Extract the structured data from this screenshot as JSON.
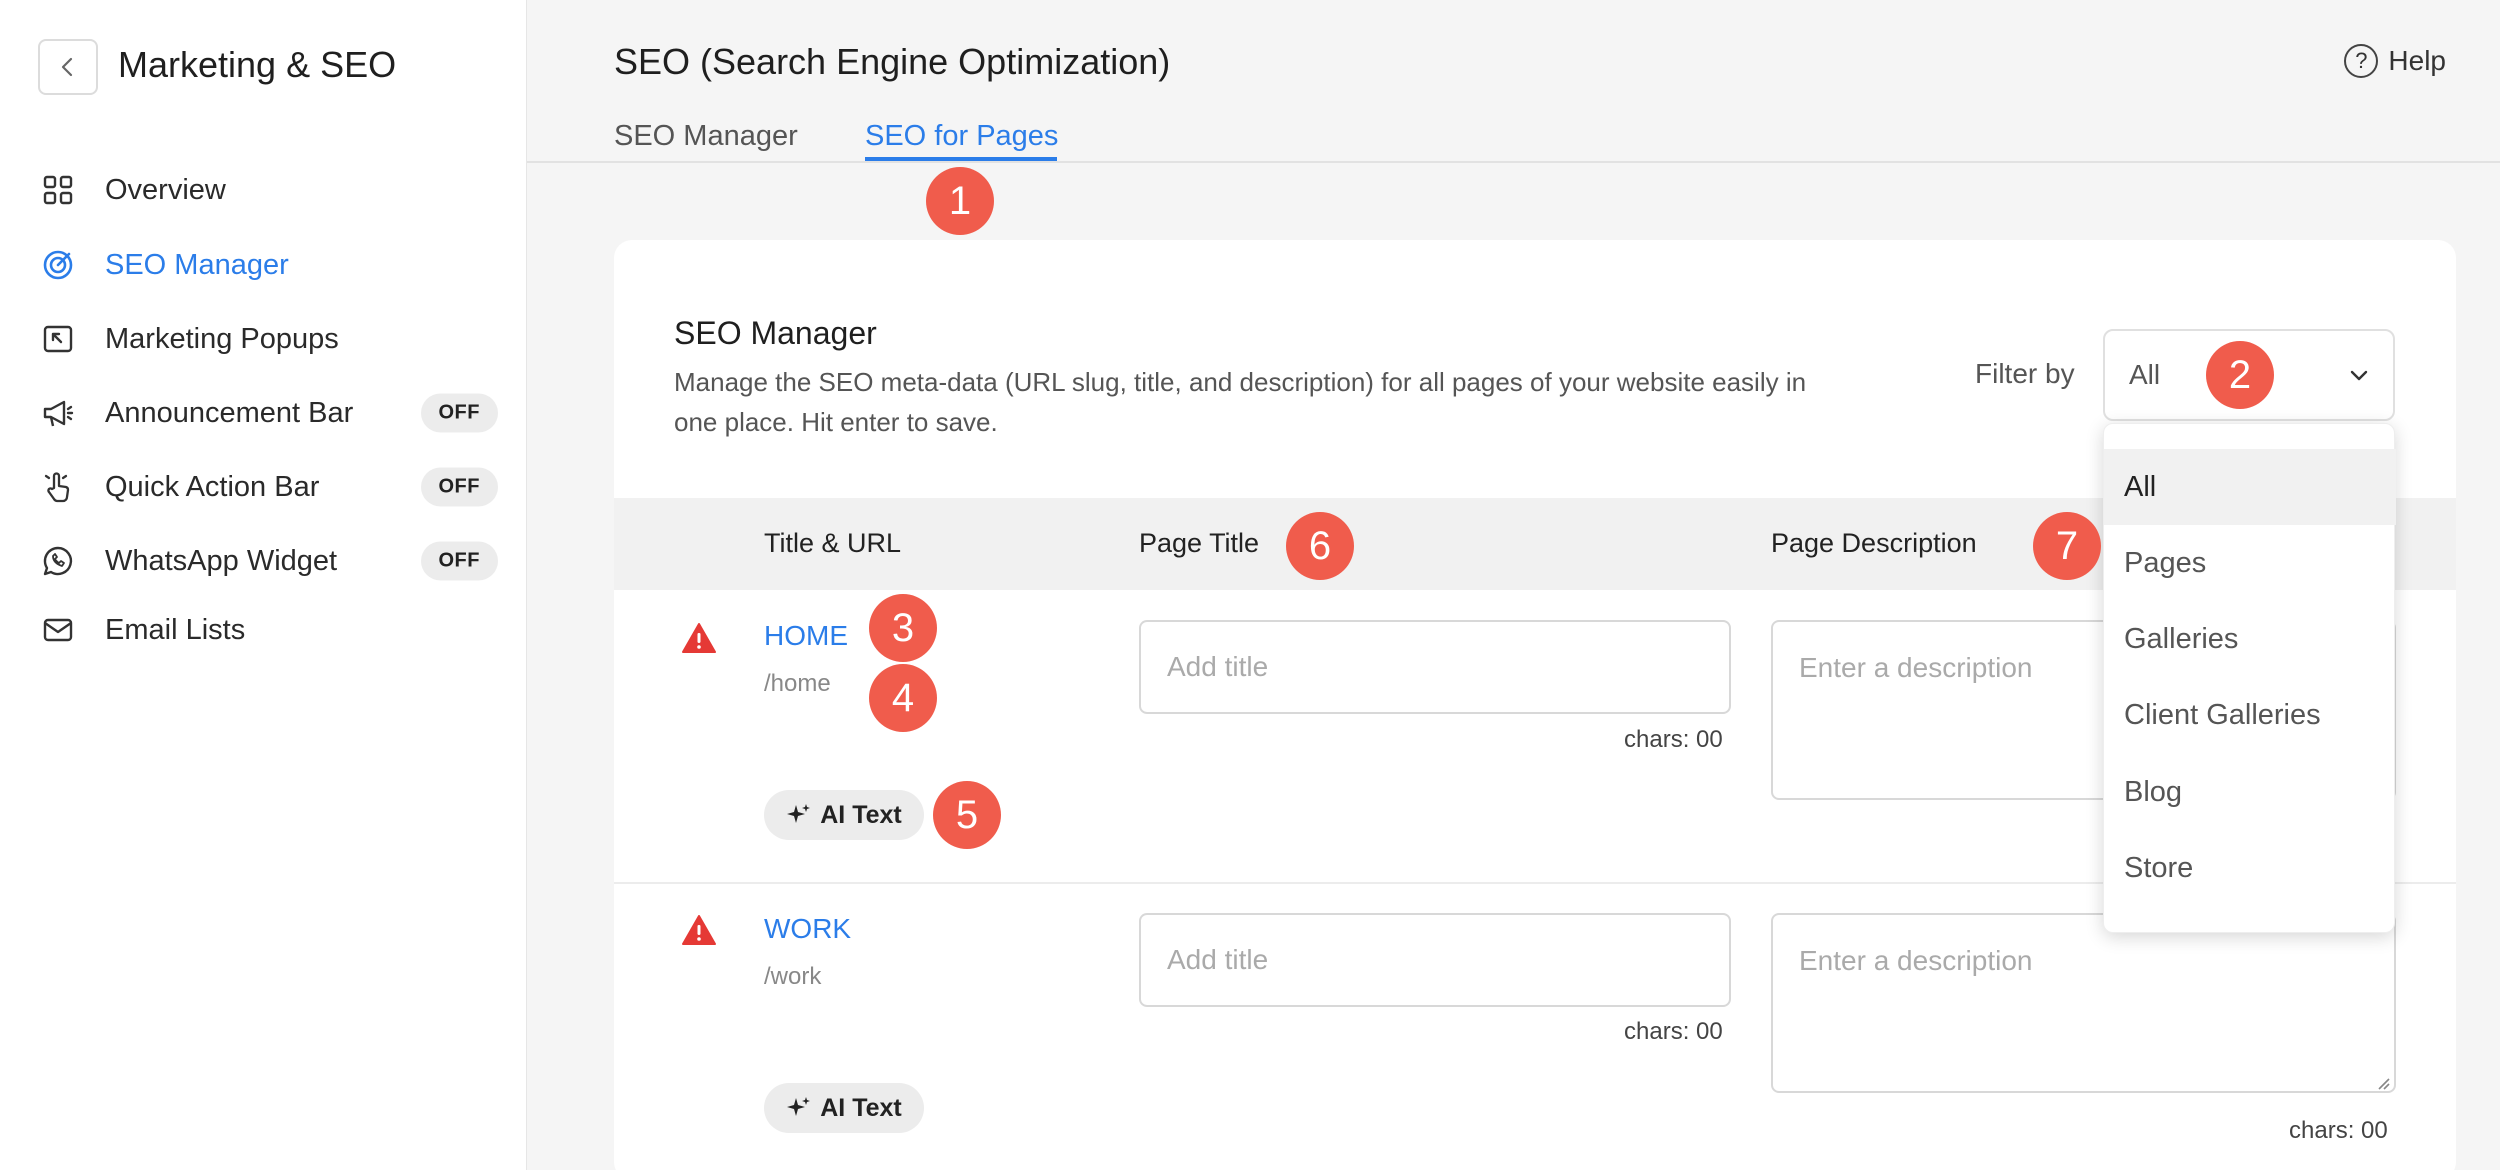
{
  "sidebar": {
    "title": "Marketing & SEO",
    "items": [
      {
        "label": "Overview",
        "icon": "grid-icon"
      },
      {
        "label": "SEO Manager",
        "icon": "target-icon"
      },
      {
        "label": "Marketing Popups",
        "icon": "popup-icon"
      },
      {
        "label": "Announcement Bar",
        "icon": "megaphone-icon",
        "toggle": "OFF"
      },
      {
        "label": "Quick Action Bar",
        "icon": "tap-icon",
        "toggle": "OFF"
      },
      {
        "label": "WhatsApp Widget",
        "icon": "whatsapp-icon",
        "toggle": "OFF"
      },
      {
        "label": "Email Lists",
        "icon": "mail-icon"
      }
    ]
  },
  "header": {
    "title": "SEO (Search Engine Optimization)",
    "help": "Help",
    "tabs": [
      "SEO Manager",
      "SEO for Pages"
    ]
  },
  "card": {
    "title": "SEO Manager",
    "description": "Manage the SEO meta-data (URL slug, title, and description) for all pages of your website easily in one place. Hit enter to save.",
    "filter_label": "Filter by",
    "filter_value": "All",
    "columns": [
      "Title & URL",
      "Page Title",
      "Page Description"
    ]
  },
  "rows": [
    {
      "name": "HOME",
      "slug": "/home",
      "ai": "AI Text",
      "title_placeholder": "Add title",
      "desc_placeholder": "Enter a description",
      "title_chars": "chars: 00"
    },
    {
      "name": "WORK",
      "slug": "/work",
      "ai": "AI Text",
      "title_placeholder": "Add title",
      "desc_placeholder": "Enter a description",
      "title_chars": "chars: 00",
      "desc_chars": "chars: 00"
    }
  ],
  "dropdown": {
    "options": [
      "All",
      "Pages",
      "Galleries",
      "Client Galleries",
      "Blog",
      "Store"
    ]
  },
  "badges": [
    "1",
    "2",
    "3",
    "4",
    "5",
    "6",
    "7"
  ],
  "colors": {
    "accent": "#2b7de9",
    "badge": "#f05c4c",
    "warning": "#e53935"
  }
}
